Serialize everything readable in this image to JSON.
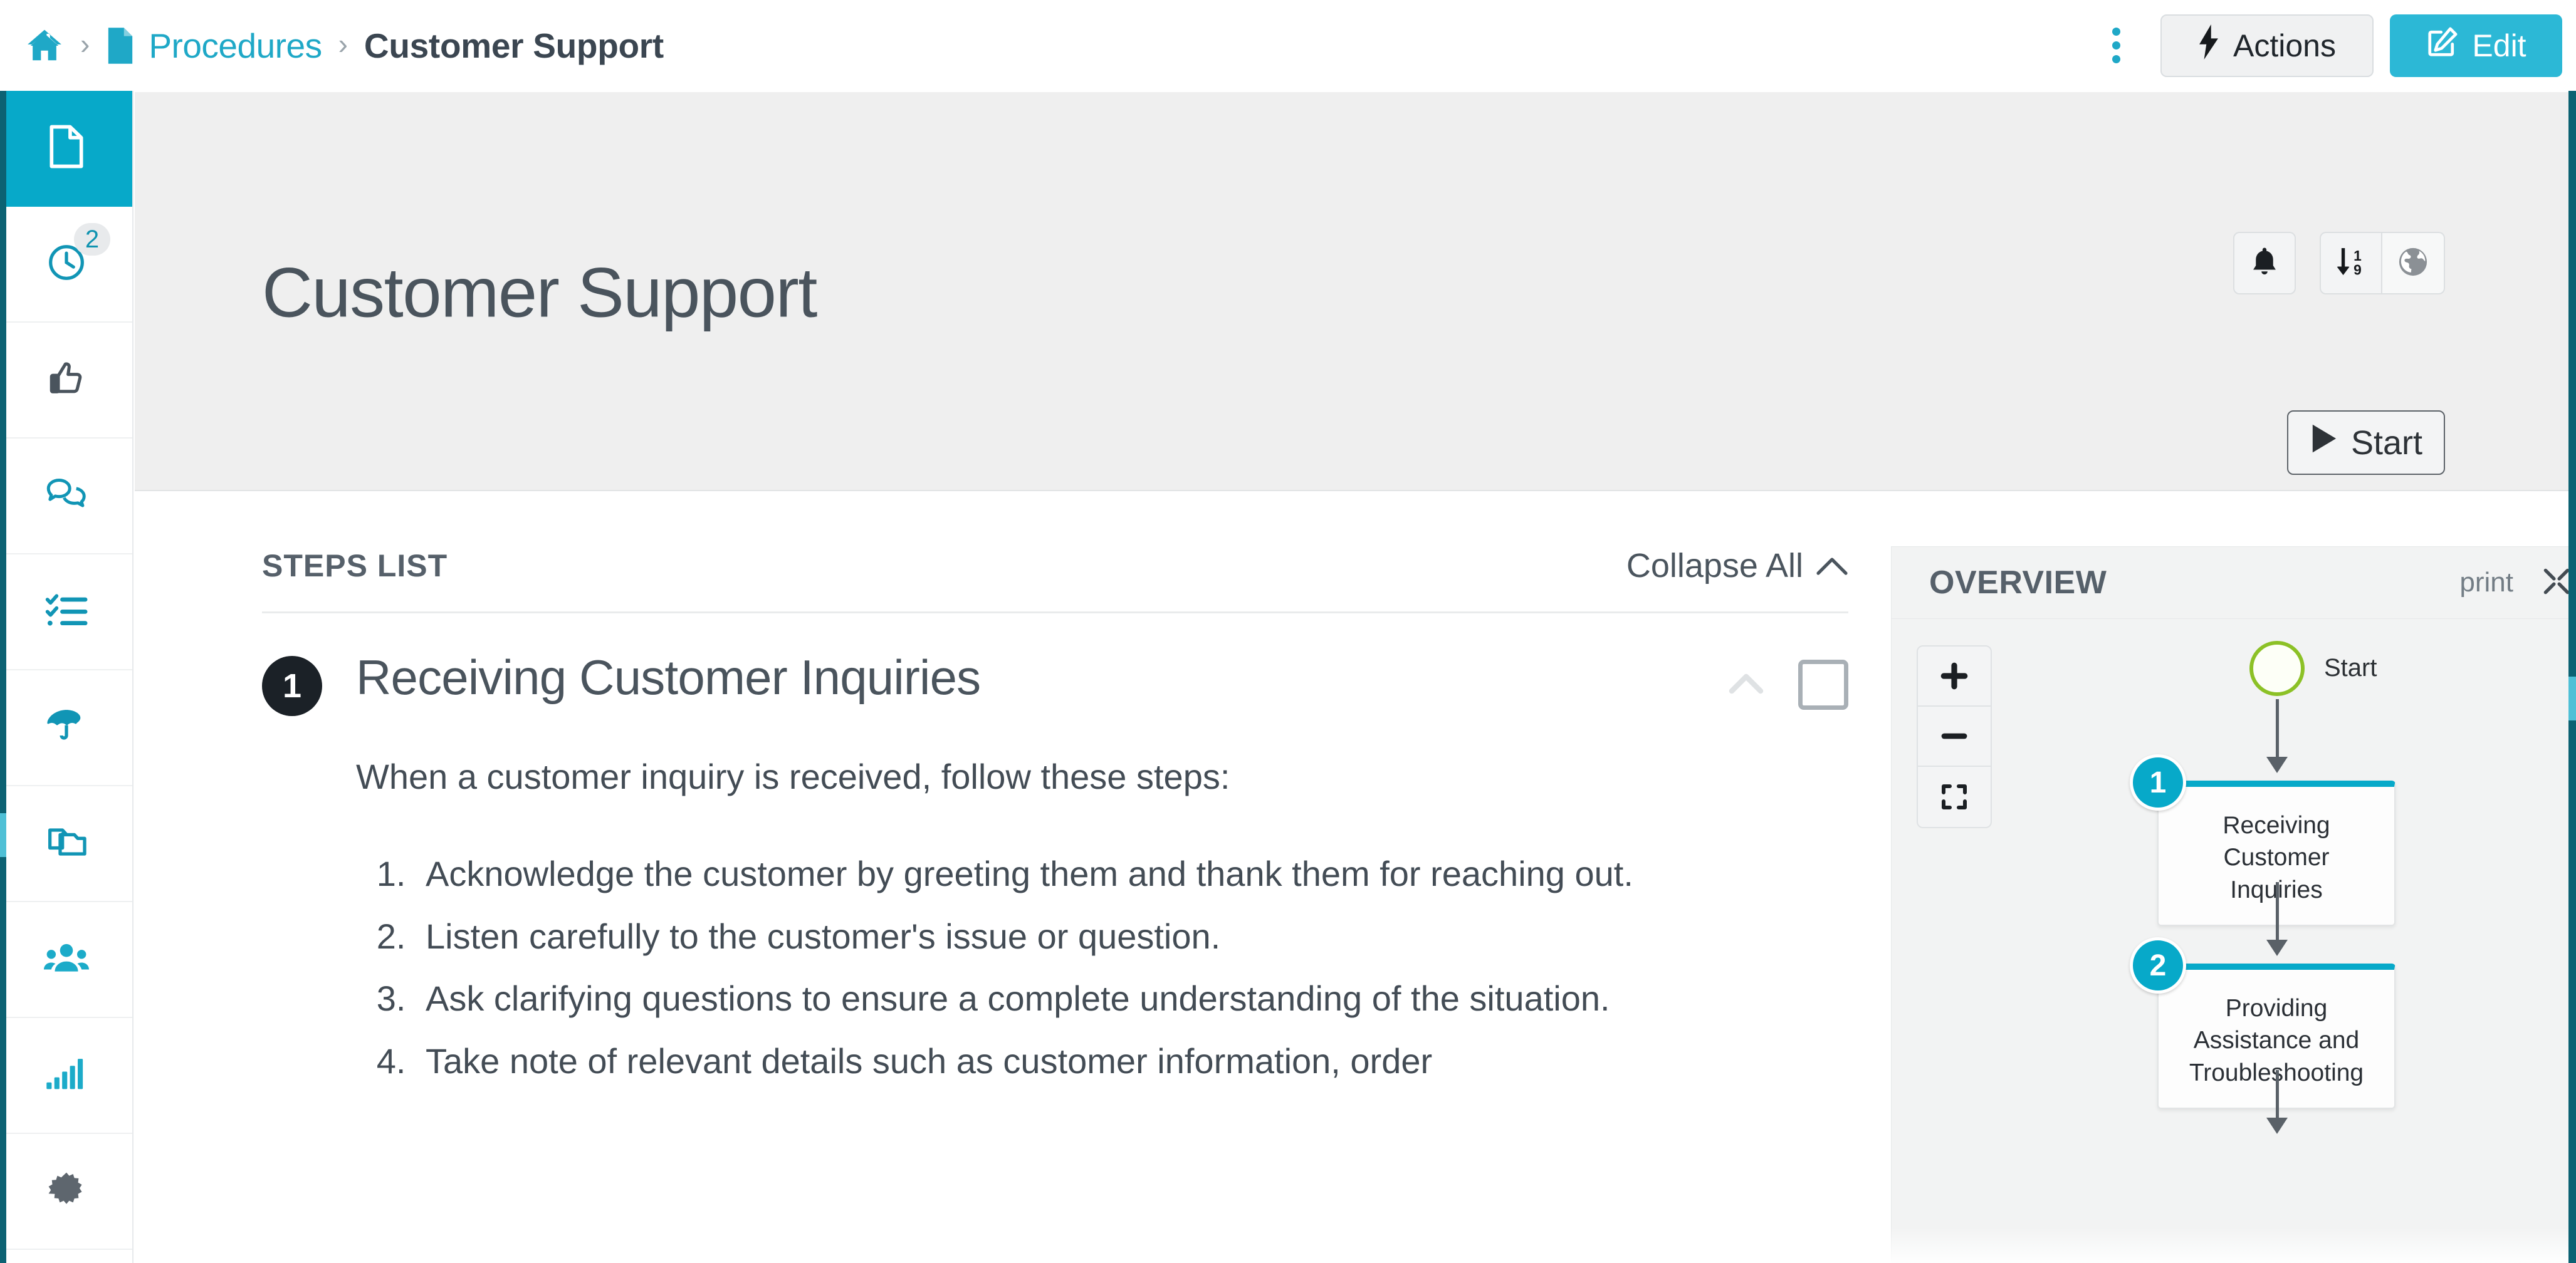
{
  "breadcrumb": {
    "home_icon": "home-icon",
    "doc_icon": "document-icon",
    "separator": "›",
    "parent": "Procedures",
    "current": "Customer Support"
  },
  "topbar": {
    "kebab_icon": "more-vertical-icon",
    "actions_label": "Actions",
    "actions_icon": "bolt-icon",
    "edit_label": "Edit",
    "edit_icon": "pencil-square-icon",
    "accent_color": "#2cb8d6"
  },
  "sidebar": {
    "items": [
      {
        "name": "documents",
        "icon": "document-page-icon",
        "active": true,
        "badge": null
      },
      {
        "name": "history",
        "icon": "clock-icon",
        "active": false,
        "badge": "2"
      },
      {
        "name": "approvals",
        "icon": "thumbs-up-icon",
        "active": false,
        "badge": null
      },
      {
        "name": "comments",
        "icon": "chat-bubbles-icon",
        "active": false,
        "badge": null
      },
      {
        "name": "tasks",
        "icon": "checklist-icon",
        "active": false,
        "badge": null
      },
      {
        "name": "risk",
        "icon": "umbrella-icon",
        "active": false,
        "badge": null
      },
      {
        "name": "copies",
        "icon": "copy-documents-icon",
        "active": false,
        "badge": null
      },
      {
        "name": "people",
        "icon": "users-group-icon",
        "active": false,
        "badge": null
      },
      {
        "name": "reports",
        "icon": "bar-chart-icon",
        "active": false,
        "badge": null
      },
      {
        "name": "settings",
        "icon": "gear-burst-icon",
        "active": false,
        "badge": null
      }
    ],
    "active_color": "#07a9c9"
  },
  "page_header": {
    "title": "Customer Support",
    "icon_buttons": [
      {
        "name": "notifications",
        "icon": "bell-icon"
      },
      {
        "name": "sort-order",
        "icon": "sort-numeric-down-icon"
      },
      {
        "name": "language",
        "icon": "globe-icon"
      }
    ],
    "start_label": "Start",
    "start_icon": "play-icon",
    "background": "#efefef"
  },
  "steps_panel": {
    "heading": "STEPS LIST",
    "collapse_all_label": "Collapse All",
    "collapse_all_icon": "chevron-up-icon",
    "steps": [
      {
        "number": "1",
        "title": "Receiving Customer Inquiries",
        "collapse_icon": "chevron-up-icon",
        "checkbox_name": "step-checkbox",
        "intro": "When a customer inquiry is received, follow these steps:",
        "items": [
          "Acknowledge the customer by greeting them and thank them for reaching out.",
          "Listen carefully to the customer's issue or question.",
          "Ask clarifying questions to ensure a complete understanding of the situation.",
          "Take note of relevant details such as customer information, order"
        ]
      }
    ]
  },
  "overview_panel": {
    "heading": "OVERVIEW",
    "print_label": "print",
    "expand_icon": "expand-arrows-icon",
    "collapse_icon": "chevron-right-icon",
    "zoom_controls": [
      {
        "name": "zoom-in",
        "glyph": "+"
      },
      {
        "name": "zoom-out",
        "glyph": "−"
      },
      {
        "name": "fit-to-screen",
        "glyph": "fullscreen-icon"
      }
    ],
    "flow": {
      "start_label": "Start",
      "start_color": "#8cc126",
      "node_accent": "#07a9c9",
      "nodes": [
        {
          "number": "1",
          "label": "Receiving Customer Inquiries"
        },
        {
          "number": "2",
          "label": "Providing Assistance and Troubleshooting"
        }
      ]
    }
  }
}
